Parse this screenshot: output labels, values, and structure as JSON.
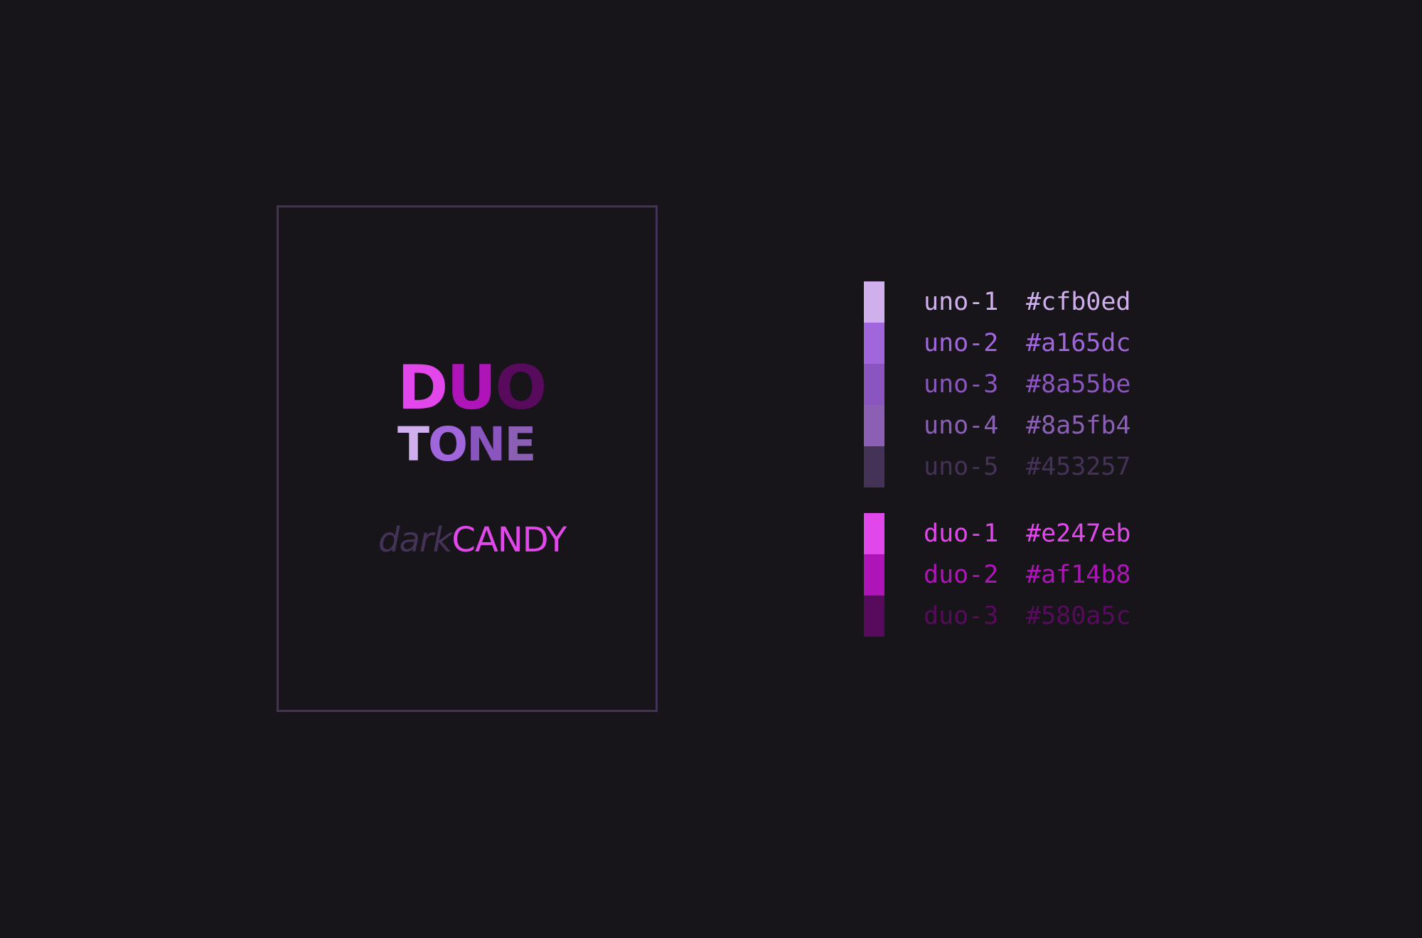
{
  "colors": {
    "background": "#17151a",
    "card_border": "#453257"
  },
  "logo": {
    "line1": [
      {
        "char": "D",
        "color": "#e247eb"
      },
      {
        "char": "U",
        "color": "#af14b8"
      },
      {
        "char": "O",
        "color": "#580a5c"
      }
    ],
    "line2": [
      {
        "char": "T",
        "color": "#cfb0ed"
      },
      {
        "char": "O",
        "color": "#a165dc"
      },
      {
        "char": "N",
        "color": "#8a55be"
      },
      {
        "char": "E",
        "color": "#8a5fb4"
      }
    ]
  },
  "tagline": {
    "dark": "dark",
    "candy": "CANDY",
    "dark_color": "#453257",
    "candy_color": "#e247eb"
  },
  "palette": {
    "uno": [
      {
        "name": "uno-1",
        "hex": "#cfb0ed"
      },
      {
        "name": "uno-2",
        "hex": "#a165dc"
      },
      {
        "name": "uno-3",
        "hex": "#8a55be"
      },
      {
        "name": "uno-4",
        "hex": "#8a5fb4"
      },
      {
        "name": "uno-5",
        "hex": "#453257"
      }
    ],
    "duo": [
      {
        "name": "duo-1",
        "hex": "#e247eb"
      },
      {
        "name": "duo-2",
        "hex": "#af14b8"
      },
      {
        "name": "duo-3",
        "hex": "#580a5c"
      }
    ]
  }
}
